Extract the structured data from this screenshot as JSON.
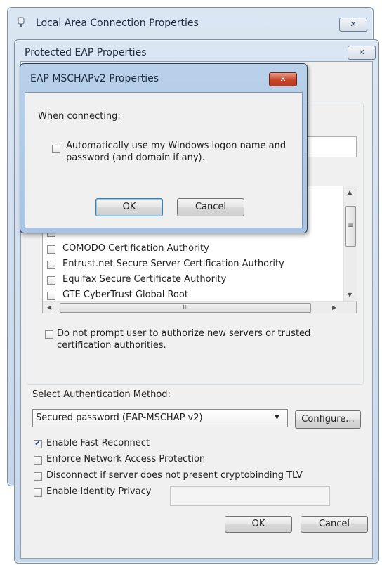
{
  "window_back": {
    "title": "Local Area Connection Properties",
    "close_label": "✕"
  },
  "window_peap": {
    "title": "Protected EAP Properties",
    "close_label": "✕",
    "cert_list": [
      {
        "label": "COMODO Certification Authority",
        "checked": false
      },
      {
        "label": "Entrust.net Secure Server Certification Authority",
        "checked": false
      },
      {
        "label": "Equifax Secure Certificate Authority",
        "checked": false
      },
      {
        "label": "GTE CyberTrust Global Root",
        "checked": false
      }
    ],
    "scroll_grip": "III",
    "scroll_grip_v": "≡",
    "no_prompt_label": "Do not prompt user to authorize new servers or trusted",
    "no_prompt_label_2": "certification authorities.",
    "auth_method_label": "Select Authentication Method:",
    "auth_method_value": "Secured password (EAP-MSCHAP v2)",
    "configure_label": "Configure...",
    "options": [
      {
        "label": "Enable Fast Reconnect",
        "checked": true
      },
      {
        "label": "Enforce Network Access Protection",
        "checked": false
      },
      {
        "label": "Disconnect if server does not present cryptobinding TLV",
        "checked": false
      },
      {
        "label": "Enable Identity Privacy",
        "checked": false
      }
    ],
    "ok_label": "OK",
    "cancel_label": "Cancel"
  },
  "window_mschap": {
    "title": "EAP MSCHAPv2 Properties",
    "close_label": "✕",
    "when_connecting": "When connecting:",
    "auto_logon_label": "Automatically use my Windows logon name and",
    "auto_logon_label_2": "password (and domain if any).",
    "auto_logon_checked": false,
    "ok_label": "OK",
    "cancel_label": "Cancel"
  }
}
